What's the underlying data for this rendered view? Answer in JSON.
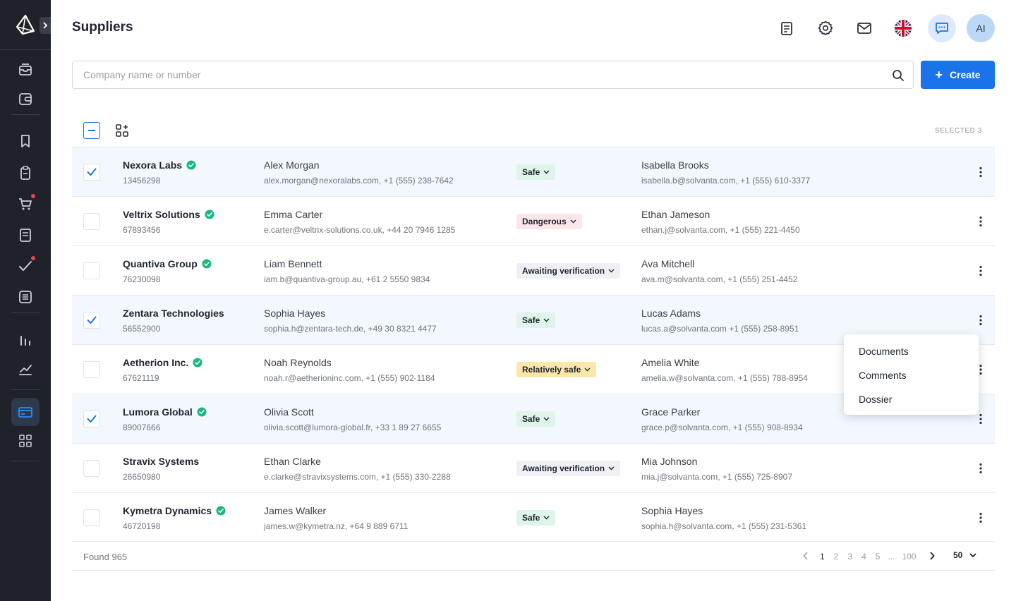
{
  "sidebar": {
    "icons": [
      "logo-icon",
      "inbox-icon",
      "wallet-icon",
      "bookmark-icon",
      "clipboard-icon",
      "cart-icon",
      "document-icon",
      "check-icon",
      "list-icon",
      "bar-chart-icon",
      "trend-chart-icon",
      "card-icon",
      "grid-icon"
    ],
    "active_item": "card-icon",
    "notification_color": "#e5484d"
  },
  "header": {
    "title": "Suppliers",
    "avatar_initials": "AI",
    "icons": [
      "notes-icon",
      "gear-icon",
      "mail-icon",
      "uk-flag-icon",
      "chat-icon"
    ]
  },
  "search": {
    "placeholder": "Company name or number",
    "value": ""
  },
  "toolbar": {
    "create_label": "Create",
    "selected_label": "SELECTED 3"
  },
  "colors": {
    "accent": "#1a73e8",
    "verified": "#16b980",
    "safe_bg": "#dff5ea",
    "dangerous_bg": "#fde6ea",
    "awaiting_bg": "#eef0f3",
    "relatively_bg": "#fbe7a8"
  },
  "rows": [
    {
      "selected": true,
      "verified": true,
      "company": "Nexora Labs",
      "number": "13456298",
      "contact_name": "Alex Morgan",
      "contact_info": "alex.morgan@nexoralabs.com, +1 (555) 238-7642",
      "status": "Safe",
      "status_type": "safe",
      "manager_name": "Isabella Brooks",
      "manager_info": "isabella.b@solvanta.com, +1 (555) 610-3377"
    },
    {
      "selected": false,
      "verified": true,
      "company": "Veltrix Solutions",
      "number": "67893456",
      "contact_name": "Emma Carter",
      "contact_info": "e.carter@veltrix-solutions.co.uk, +44 20 7946 1285",
      "status": "Dangerous",
      "status_type": "dangerous",
      "manager_name": "Ethan Jameson",
      "manager_info": "ethan.j@solvanta.com, +1 (555) 221-4450"
    },
    {
      "selected": false,
      "verified": true,
      "company": "Quantiva Group",
      "number": "76230098",
      "contact_name": "Liam Bennett",
      "contact_info": "iam.b@quantiva-group.au, +61 2 5550 9834",
      "status": "Awaiting verification",
      "status_type": "awaiting",
      "manager_name": "Ava Mitchell",
      "manager_info": "ava.m@solvanta.com, +1 (555) 251-4452"
    },
    {
      "selected": true,
      "verified": false,
      "company": "Zentara Technologies",
      "number": "56552900",
      "contact_name": "Sophia Hayes",
      "contact_info": "sophia.h@zentara-tech.de, +49 30 8321 4477",
      "status": "Safe",
      "status_type": "safe",
      "manager_name": "Lucas Adams",
      "manager_info": "lucas.a@solvanta.com +1 (555) 258-8951"
    },
    {
      "selected": false,
      "verified": true,
      "company": "Aetherion Inc.",
      "number": "67621119",
      "contact_name": "Noah Reynolds",
      "contact_info": "noah.r@aetherioninc.com, +1 (555) 902-1184",
      "status": "Relatively safe",
      "status_type": "relatively",
      "manager_name": "Amelia White",
      "manager_info": "amelia.w@solvanta.com, +1 (555) 788-8954"
    },
    {
      "selected": true,
      "verified": true,
      "company": "Lumora Global",
      "number": "89007666",
      "contact_name": "Olivia Scott",
      "contact_info": "olivia.scott@lumora-global.fr, +33 1 89 27 6655",
      "status": "Safe",
      "status_type": "safe",
      "manager_name": "Grace Parker",
      "manager_info": "grace.p@solvanta.com, +1 (555) 908-8934"
    },
    {
      "selected": false,
      "verified": false,
      "company": "Stravix Systems",
      "number": "26650980",
      "contact_name": "Ethan Clarke",
      "contact_info": "e.clarke@stravixsystems.com, +1 (555) 330-2288",
      "status": "Awaiting verification",
      "status_type": "awaiting",
      "manager_name": "Mia Johnson",
      "manager_info": " mia.j@solvanta.com, +1 (555) 725-8907"
    },
    {
      "selected": false,
      "verified": true,
      "company": "Kymetra Dynamics",
      "number": "46720198",
      "contact_name": "James Walker",
      "contact_info": "james.w@kymetra.nz, +64 9 889 6711",
      "status": "Safe",
      "status_type": "safe",
      "manager_name": "Sophia Hayes",
      "manager_info": " sophia.h@solvanta.com, +1 (555) 231-5361"
    }
  ],
  "context_menu": {
    "items": [
      "Documents",
      "Comments",
      "Dossier"
    ]
  },
  "footer": {
    "found_label": "Found 965",
    "pages": [
      "1",
      "2",
      "3",
      "4",
      "5",
      "...",
      "100"
    ],
    "current_page": "1",
    "per_page": "50"
  }
}
